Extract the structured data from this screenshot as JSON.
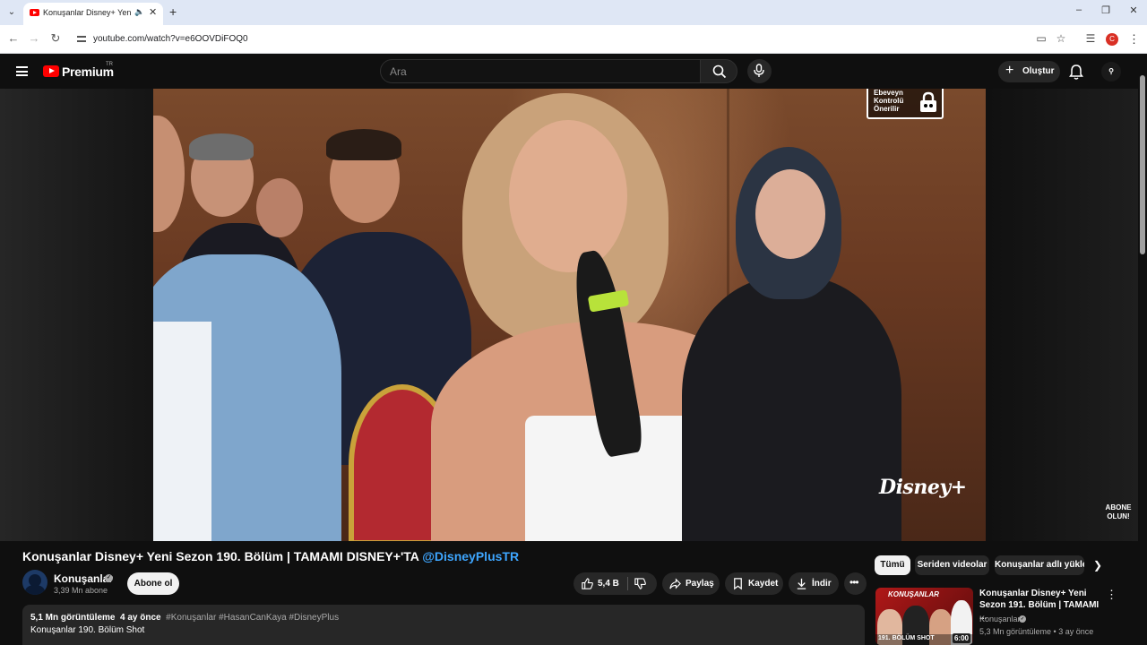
{
  "browser": {
    "tab_title": "Konuşanlar Disney+ Yeni Se",
    "url": "youtube.com/watch?v=e6OOVDiFOQ0",
    "profile_initial": "C"
  },
  "masthead": {
    "logo_text": "Premium",
    "logo_sup": "TR",
    "search_placeholder": "Ara",
    "create_label": "Oluştur"
  },
  "player": {
    "parental_label": "Ebeveyn Kontrolü Önerilir",
    "watermark": "Disney+",
    "subscribe_watermark": "ABONE OLUN!"
  },
  "video": {
    "title": "Konuşanlar Disney+ Yeni Sezon 190. Bölüm | TAMAMI DISNEY+'TA",
    "title_handle": "@DisneyPlusTR",
    "channel_name": "Konuşanlar",
    "subscribers": "3,39 Mn abone",
    "subscribe_label": "Abone ol",
    "likes": "5,4 B",
    "share_label": "Paylaş",
    "save_label": "Kaydet",
    "download_label": "İndir",
    "views": "5,1 Mn görüntüleme",
    "age": "4 ay önce",
    "tags": "#Konuşanlar #HasanCanKaya #DisneyPlus",
    "description_line": "Konuşanlar 190. Bölüm Shot"
  },
  "sidebar": {
    "chips": [
      "Tümü",
      "Seriden videolar",
      "Konuşanlar adlı yükle"
    ],
    "recommendation": {
      "thumb_title": "KONUŞANLAR",
      "thumb_band": "191. BÖLÜM SHOT",
      "duration": "6:00",
      "title": "Konuşanlar Disney+ Yeni Sezon 191. Bölüm | TAMAMI ...",
      "channel": "Konuşanlar",
      "stats": "5,3 Mn görüntüleme • 3 ay önce"
    }
  },
  "colors": {
    "brand_red": "#ff0000",
    "link_blue": "#3ea6ff",
    "background": "#0f0f0f",
    "pill_bg": "#272727"
  }
}
